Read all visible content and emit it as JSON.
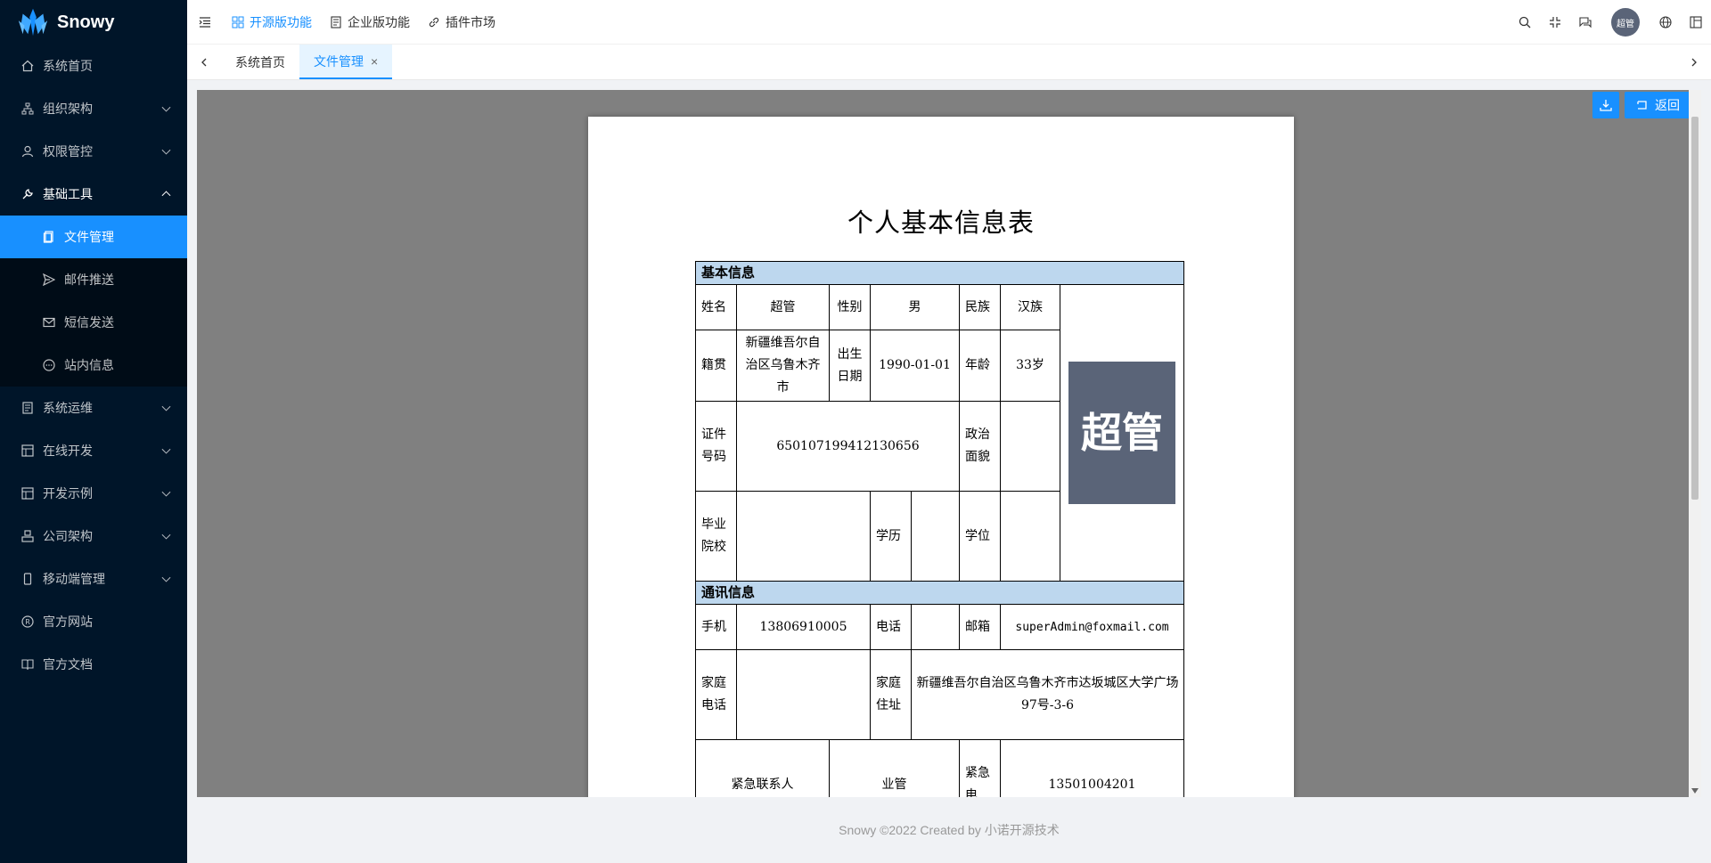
{
  "app": {
    "name": "Snowy"
  },
  "sidebar": {
    "items": [
      {
        "label": "系统首页",
        "icon": "home-icon"
      },
      {
        "label": "组织架构",
        "icon": "org-icon"
      },
      {
        "label": "权限管控",
        "icon": "user-icon"
      },
      {
        "label": "基础工具",
        "icon": "wrench-icon"
      },
      {
        "label": "系统运维",
        "icon": "ops-icon"
      },
      {
        "label": "在线开发",
        "icon": "dev-icon"
      },
      {
        "label": "开发示例",
        "icon": "example-icon"
      },
      {
        "label": "公司架构",
        "icon": "company-icon"
      },
      {
        "label": "移动端管理",
        "icon": "mobile-icon"
      },
      {
        "label": "官方网站",
        "icon": "registered-icon"
      },
      {
        "label": "官方文档",
        "icon": "doc-icon"
      }
    ],
    "submenu": [
      {
        "label": "文件管理",
        "icon": "file-icon"
      },
      {
        "label": "邮件推送",
        "icon": "send-icon"
      },
      {
        "label": "短信发送",
        "icon": "mail-icon"
      },
      {
        "label": "站内信息",
        "icon": "message-icon"
      }
    ]
  },
  "header": {
    "menus": [
      {
        "label": "开源版功能"
      },
      {
        "label": "企业版功能"
      },
      {
        "label": "插件市场"
      }
    ],
    "avatar_text": "超管"
  },
  "tabs": [
    {
      "label": "系统首页"
    },
    {
      "label": "文件管理"
    }
  ],
  "viewer": {
    "back_label": "返回"
  },
  "document": {
    "title": "个人基本信息表",
    "sections": {
      "basic": "基本信息",
      "contact": "通讯信息"
    },
    "labels": {
      "name": "姓名",
      "gender": "性别",
      "ethnicity": "民族",
      "native_place": "籍贯",
      "birth_date": "出生日期",
      "age": "年龄",
      "id_number": "证件号码",
      "political": "政治面貌",
      "school": "毕业院校",
      "education": "学历",
      "degree": "学位",
      "mobile": "手机",
      "phone": "电话",
      "email": "邮箱",
      "home_phone": "家庭电话",
      "home_address": "家庭住址",
      "emergency_contact": "紧急联系人",
      "emergency_phone": "紧急电"
    },
    "values": {
      "name": "超管",
      "gender": "男",
      "ethnicity": "汉族",
      "native_place": "新疆维吾尔自治区乌鲁木齐市",
      "birth_date": "1990-01-01",
      "age": "33岁",
      "id_number": "650107199412130656",
      "political": "",
      "school": "",
      "education": "",
      "degree": "",
      "mobile": "13806910005",
      "phone": "",
      "email": "superAdmin@foxmail.com",
      "home_phone": "",
      "home_address": "新疆维吾尔自治区乌鲁木齐市达坂城区大学广场97号-3-6",
      "emergency_contact": "业管",
      "emergency_phone": "13501004201",
      "photo_text": "超管"
    }
  },
  "footer": {
    "text": "Snowy ©2022 Created by 小诺开源技术"
  },
  "colors": {
    "primary": "#1890ff",
    "sidebar_bg": "#001529",
    "section_bg": "#bdd7ee",
    "photo_bg": "#5a6478"
  }
}
